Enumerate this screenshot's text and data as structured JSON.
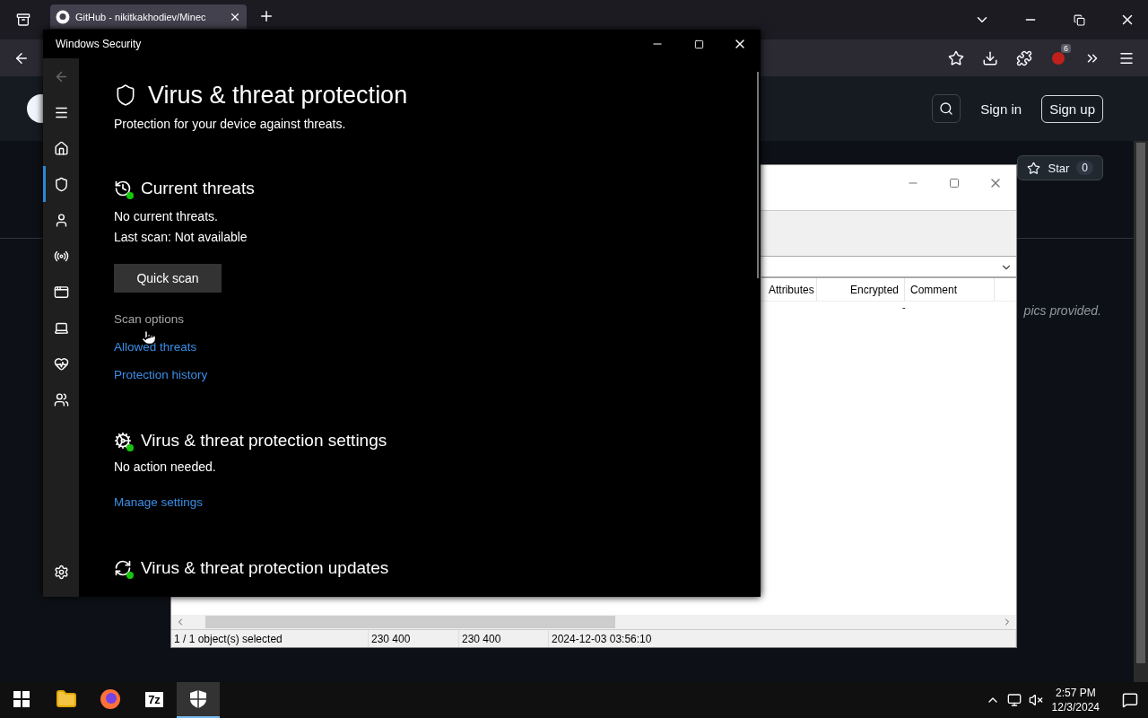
{
  "browser": {
    "tabs": [
      {
        "title": "GitHub - nikitkakhodiev/Minec",
        "selected": true
      }
    ],
    "addon_badge": "6"
  },
  "github": {
    "sign_in": "Sign in",
    "sign_up": "Sign up",
    "star": {
      "label": "Star",
      "count": "0"
    },
    "about_fragment": "pics provided."
  },
  "archive_window": {
    "columns": [
      "Attributes",
      "Encrypted",
      "Comment"
    ],
    "row_fragment": "-",
    "status_bar": [
      "1 / 1 object(s) selected",
      "230 400",
      "230 400",
      "2024-12-03 03:56:10"
    ]
  },
  "security_window": {
    "title": "Windows Security",
    "nav": [
      {
        "kind": "home",
        "selected": false
      },
      {
        "kind": "shield",
        "selected": true
      },
      {
        "kind": "account",
        "selected": false
      },
      {
        "kind": "network",
        "selected": false
      },
      {
        "kind": "app",
        "selected": false
      },
      {
        "kind": "device",
        "selected": false
      },
      {
        "kind": "health",
        "selected": false
      },
      {
        "kind": "family",
        "selected": false
      }
    ],
    "page_title": "Virus & threat protection",
    "subtitle": "Protection for your device against threats.",
    "sections": [
      {
        "kind": "threats",
        "title": "Current threats",
        "lines": [
          "No current threats.",
          "Last scan: Not available"
        ],
        "button": "Quick scan",
        "links": [
          {
            "label": "Scan options",
            "hovered": true
          },
          {
            "label": "Allowed threats",
            "hovered": false
          },
          {
            "label": "Protection history",
            "hovered": false
          }
        ]
      },
      {
        "kind": "settings",
        "title": "Virus & threat protection settings",
        "lines": [
          "No action needed."
        ],
        "links": [
          {
            "label": "Manage settings",
            "hovered": false
          }
        ]
      },
      {
        "kind": "updates",
        "title": "Virus & threat protection updates"
      }
    ]
  },
  "taskbar": {
    "apps": [
      {
        "kind": "explorer",
        "selected": false
      },
      {
        "kind": "firefox",
        "selected": false
      },
      {
        "kind": "archiver",
        "label": "7z",
        "selected": false
      },
      {
        "kind": "security",
        "selected": true
      }
    ],
    "time": "2:57 PM",
    "date": "12/3/2024"
  }
}
